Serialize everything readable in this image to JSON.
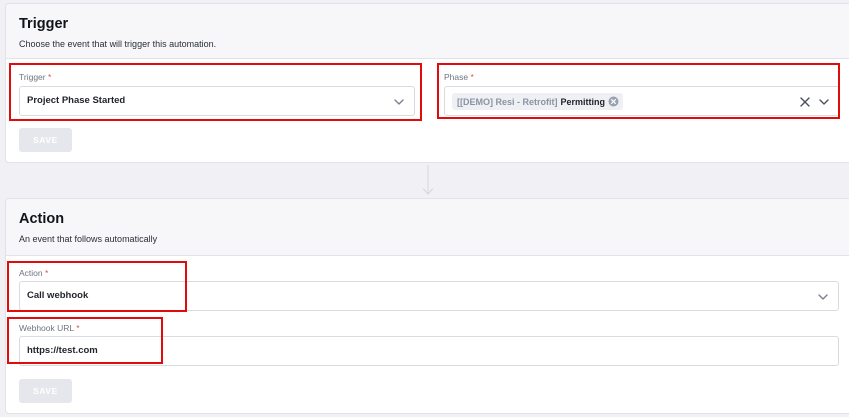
{
  "trigger_section": {
    "title": "Trigger",
    "description": "Choose the event that will trigger this automation.",
    "trigger_field": {
      "label": "Trigger",
      "required_mark": "*",
      "value": "Project Phase Started"
    },
    "phase_field": {
      "label": "Phase",
      "required_mark": "*",
      "chip_prefix": "[[DEMO] Resi - Retrofit]",
      "chip_value": "Permitting"
    },
    "save_label": "SAVE"
  },
  "action_section": {
    "title": "Action",
    "description": "An event that follows automatically",
    "action_field": {
      "label": "Action",
      "required_mark": "*",
      "value": "Call webhook"
    },
    "webhook_field": {
      "label": "Webhook URL",
      "required_mark": "*",
      "value": "https://test.com"
    },
    "save_label": "SAVE"
  },
  "icons": {
    "select_open": "chevron-down-icon",
    "clear": "close-icon",
    "chip_remove": "circle-x-icon",
    "flow": "arrow-down-icon"
  },
  "colors": {
    "highlight": "#e10b0b",
    "required": "#d9534f",
    "disabled_button": "#e6e7ec"
  }
}
